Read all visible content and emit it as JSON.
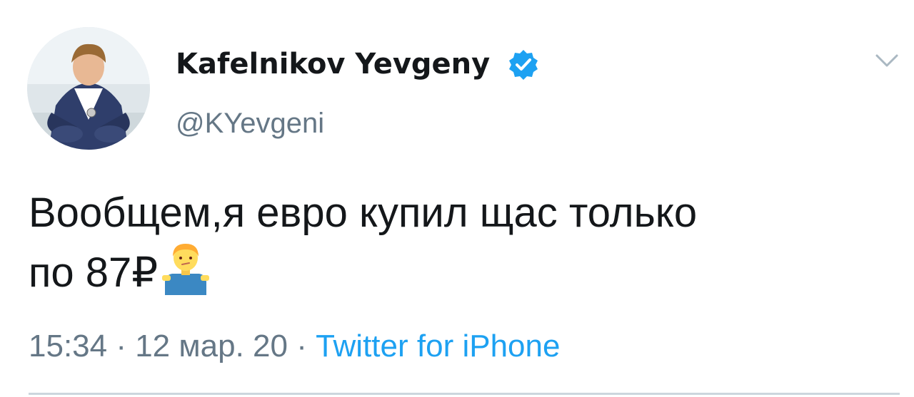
{
  "tweet": {
    "author": {
      "display_name": "Kafelnikov Yevgeny",
      "handle": "@KYevgeni",
      "verified": true,
      "avatar_icon": "profile-photo"
    },
    "menu_icon": "chevron-down-icon",
    "text_line1": "Вообщем,я евро купил щас только",
    "text_line2": "по 87₽",
    "emoji": "man-shrugging",
    "timestamp": "15:34 · 12 мар. 20",
    "separator": " · ",
    "source": "Twitter for iPhone",
    "colors": {
      "text": "#14171a",
      "secondary": "#657786",
      "link": "#1da1f2",
      "verified": "#1da1f2",
      "divider": "#ccd6dd"
    }
  }
}
